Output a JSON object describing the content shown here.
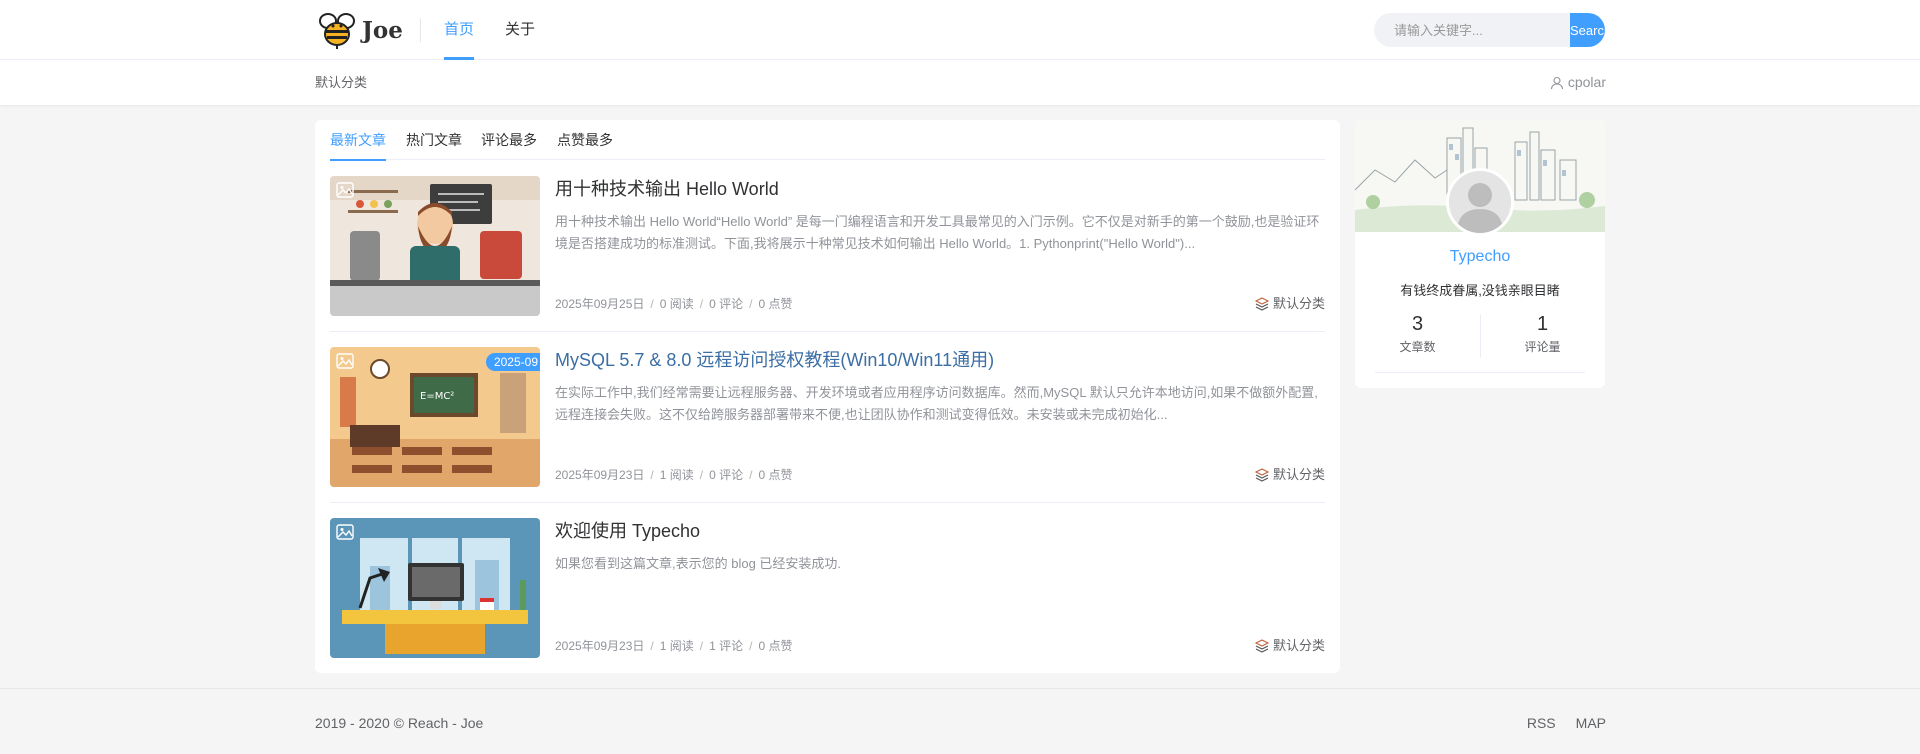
{
  "header": {
    "logo_text": "Joe",
    "nav": [
      {
        "label": "首页",
        "active": true
      },
      {
        "label": "关于",
        "active": false
      }
    ],
    "search": {
      "placeholder": "请输入关键字...",
      "button": "Search"
    }
  },
  "subbar": {
    "breadcrumb": "默认分类",
    "user": "cpolar",
    "user_icon": "user-icon"
  },
  "tabs": [
    {
      "label": "最新文章",
      "active": true
    },
    {
      "label": "热门文章",
      "active": false
    },
    {
      "label": "评论最多",
      "active": false
    },
    {
      "label": "点赞最多",
      "active": false
    }
  ],
  "articles": [
    {
      "title": "用十种技术输出 Hello World",
      "abstract": "用十种技术输出 Hello World“Hello World” 是每一门编程语言和开发工具最常见的入门示例。它不仅是对新手的第一个鼓励,也是验证环境是否搭建成功的标准测试。下面,我将展示十种常见技术如何输出 Hello World。1. Pythonprint(\"Hello World\")...",
      "date": "2025年09月25日",
      "reads": "0 阅读",
      "comments": "0 评论",
      "likes": "0 点赞",
      "category": "默认分类"
    },
    {
      "title": "MySQL 5.7 & 8.0 远程访问授权教程(Win10/Win11通用)",
      "abstract": "在实际工作中,我们经常需要让远程服务器、开发环境或者应用程序访问数据库。然而,MySQL 默认只允许本地访问,如果不做额外配置,远程连接会失败。这不仅给跨服务器部署带来不便,也让团队协作和测试变得低效。未安装或未完成初始化...",
      "date": "2025年09月23日",
      "reads": "1 阅读",
      "comments": "0 评论",
      "likes": "0 点赞",
      "category": "默认分类",
      "badge": "2025-09"
    },
    {
      "title": "欢迎使用 Typecho",
      "abstract": "如果您看到这篇文章,表示您的 blog 已经安装成功.",
      "date": "2025年09月23日",
      "reads": "1 阅读",
      "comments": "1 评论",
      "likes": "0 点赞",
      "category": "默认分类"
    }
  ],
  "sidebar": {
    "name": "Typecho",
    "motto": "有钱终成眷属,没钱亲眼目睹",
    "stats": [
      {
        "value": "3",
        "label": "文章数"
      },
      {
        "value": "1",
        "label": "评论量"
      }
    ]
  },
  "footer": {
    "copyright": "2019 - 2020 © Reach - Joe",
    "links": [
      "RSS",
      "MAP"
    ]
  },
  "colors": {
    "accent": "#409eff",
    "background": "#f5f5f5"
  }
}
